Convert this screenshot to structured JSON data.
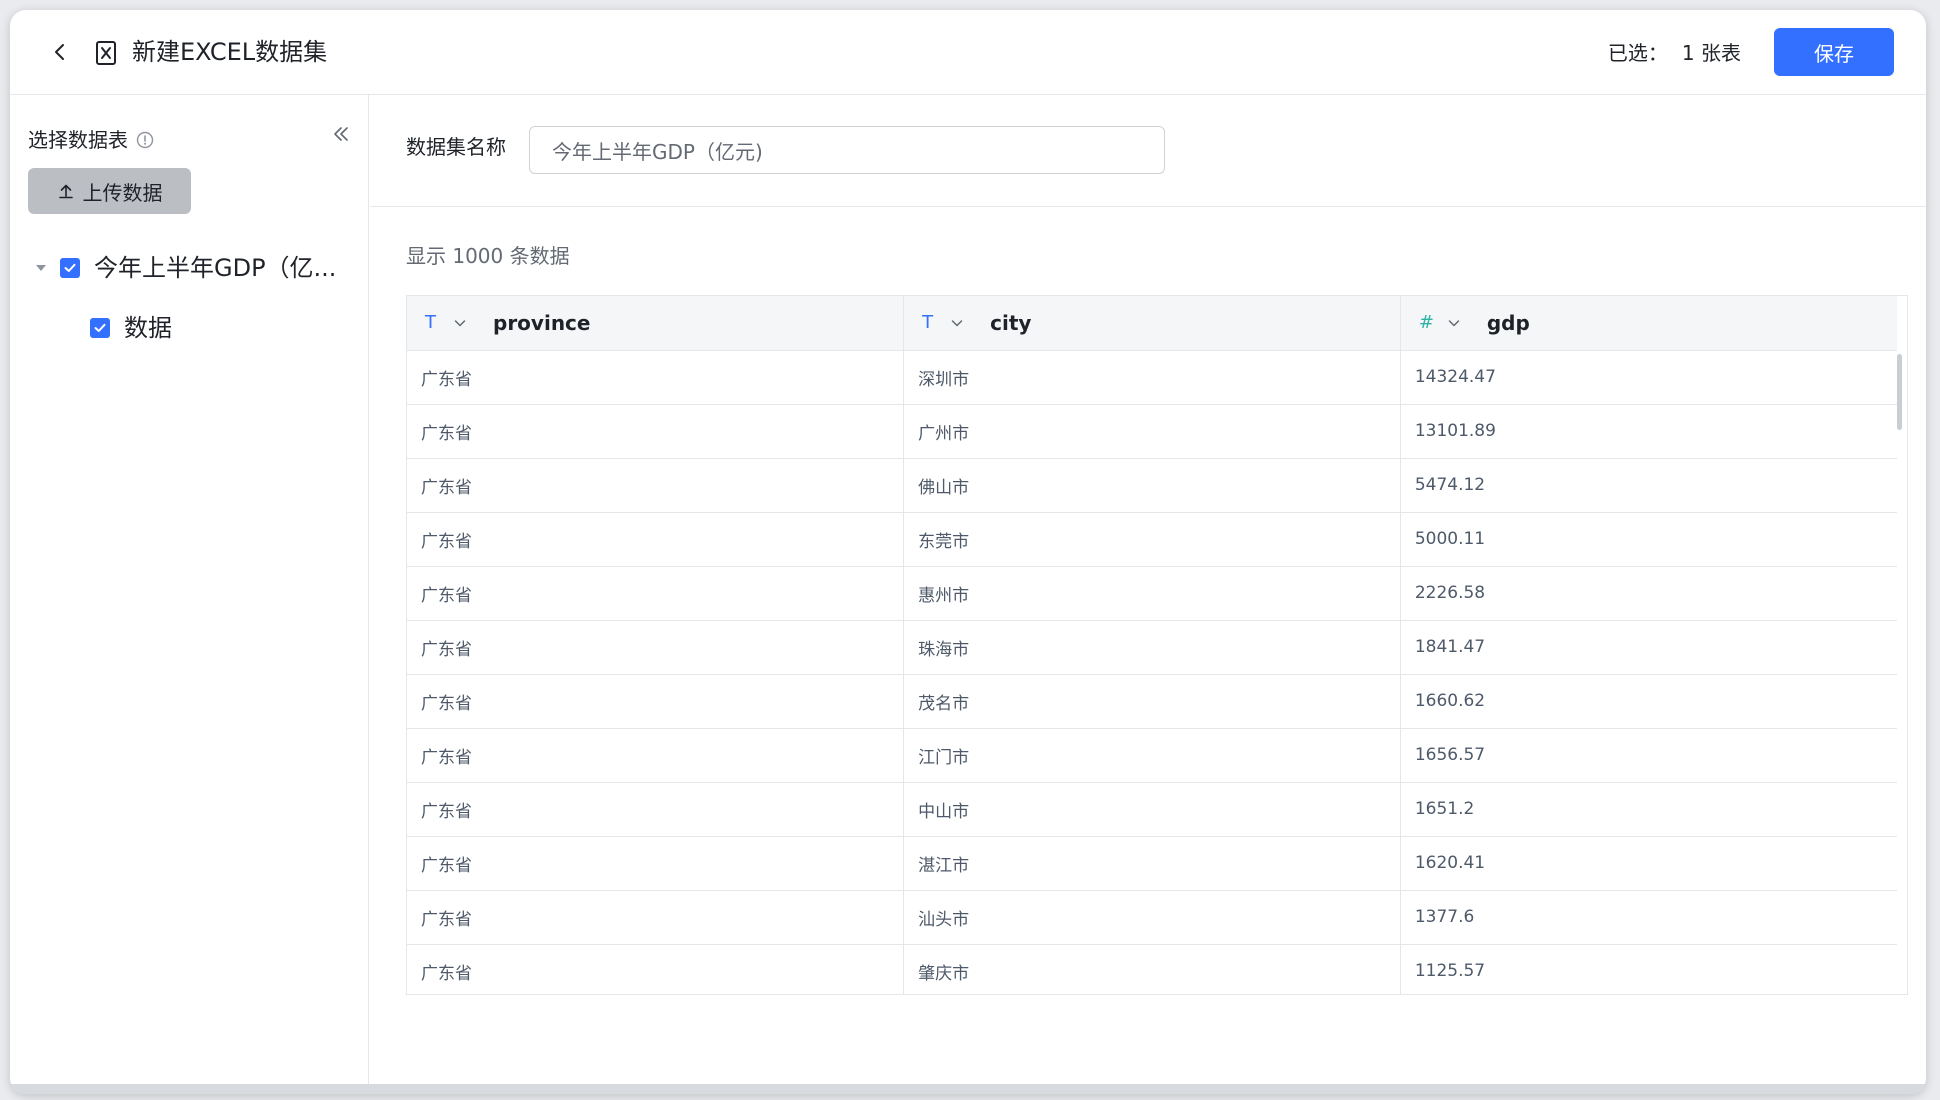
{
  "header": {
    "title": "新建EXCEL数据集",
    "selected_label": "已选：",
    "selected_count": "1 张表",
    "save_label": "保存"
  },
  "sidebar": {
    "title": "选择数据表",
    "upload_label": "上传数据",
    "tree": {
      "root_label": "今年上半年GDP（亿...",
      "child_label": "数据"
    }
  },
  "main": {
    "name_label": "数据集名称",
    "name_value": "今年上半年GDP（亿元)",
    "record_count": "显示 1000 条数据",
    "columns": [
      {
        "type_icon": "T",
        "name": "province"
      },
      {
        "type_icon": "T",
        "name": "city"
      },
      {
        "type_icon": "#",
        "name": "gdp"
      }
    ],
    "rows": [
      [
        "广东省",
        "深圳市",
        "14324.47"
      ],
      [
        "广东省",
        "广州市",
        "13101.89"
      ],
      [
        "广东省",
        "佛山市",
        "5474.12"
      ],
      [
        "广东省",
        "东莞市",
        "5000.11"
      ],
      [
        "广东省",
        "惠州市",
        "2226.58"
      ],
      [
        "广东省",
        "珠海市",
        "1841.47"
      ],
      [
        "广东省",
        "茂名市",
        "1660.62"
      ],
      [
        "广东省",
        "江门市",
        "1656.57"
      ],
      [
        "广东省",
        "中山市",
        "1651.2"
      ],
      [
        "广东省",
        "湛江市",
        "1620.41"
      ],
      [
        "广东省",
        "汕头市",
        "1377.6"
      ],
      [
        "广东省",
        "肇庆市",
        "1125.57"
      ]
    ]
  },
  "colors": {
    "primary": "#3370ff",
    "number_type": "#2fb3a5",
    "border": "#e4e6e9",
    "upload_bg": "#bbbfc4"
  }
}
